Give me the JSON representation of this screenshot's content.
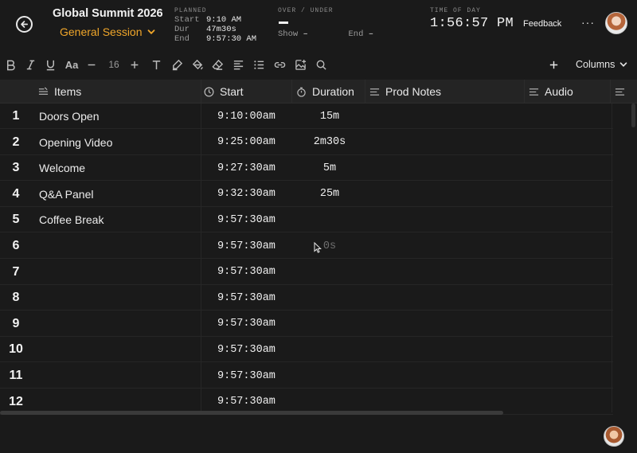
{
  "header": {
    "event_title": "Global Summit 2026",
    "session": "General Session",
    "planned": {
      "caption": "PLANNED",
      "start_label": "Start",
      "start_value": "9:10 AM",
      "dur_label": "Dur",
      "dur_value": "47m30s",
      "end_label": "End",
      "end_value": "9:57:30 AM"
    },
    "over_under": {
      "caption": "OVER / UNDER",
      "show_label": "Show",
      "show_value": "–",
      "end_label": "End",
      "end_value": "–"
    },
    "time_of_day": {
      "caption": "TIME OF DAY",
      "value": "1:56:57 PM"
    },
    "feedback_label": "Feedback",
    "more_label": "···"
  },
  "toolbar": {
    "font_size": "16",
    "columns_label": "Columns"
  },
  "columns": {
    "items": "Items",
    "start": "Start",
    "duration": "Duration",
    "prod_notes": "Prod Notes",
    "audio": "Audio"
  },
  "rows": [
    {
      "num": "1",
      "item": "Doors Open",
      "start": "9:10:00am",
      "duration": "15m"
    },
    {
      "num": "2",
      "item": "Opening Video",
      "start": "9:25:00am",
      "duration": "2m30s"
    },
    {
      "num": "3",
      "item": "Welcome",
      "start": "9:27:30am",
      "duration": "5m"
    },
    {
      "num": "4",
      "item": "Q&A Panel",
      "start": "9:32:30am",
      "duration": "25m"
    },
    {
      "num": "5",
      "item": "Coffee Break",
      "start": "9:57:30am",
      "duration": ""
    },
    {
      "num": "6",
      "item": "",
      "start": "9:57:30am",
      "duration": "0s"
    },
    {
      "num": "7",
      "item": "",
      "start": "9:57:30am",
      "duration": ""
    },
    {
      "num": "8",
      "item": "",
      "start": "9:57:30am",
      "duration": ""
    },
    {
      "num": "9",
      "item": "",
      "start": "9:57:30am",
      "duration": ""
    },
    {
      "num": "10",
      "item": "",
      "start": "9:57:30am",
      "duration": ""
    },
    {
      "num": "11",
      "item": "",
      "start": "9:57:30am",
      "duration": ""
    },
    {
      "num": "12",
      "item": "",
      "start": "9:57:30am",
      "duration": ""
    }
  ],
  "colors": {
    "accent": "#f0a62a",
    "background": "#1a1a1a",
    "header_row": "#242424"
  }
}
